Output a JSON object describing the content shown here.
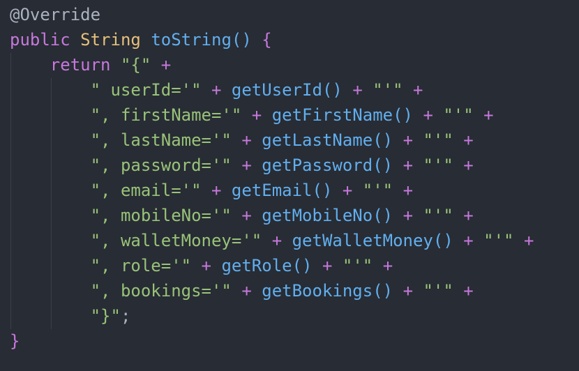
{
  "colors": {
    "background": "#282c34",
    "keyword": "#c678dd",
    "type": "#e5c07b",
    "function": "#61afef",
    "string": "#98c379",
    "plain": "#abb2bf"
  },
  "lines": [
    [
      {
        "c": "t-annotation",
        "t": "@Override"
      }
    ],
    [
      {
        "c": "t-keyword",
        "t": "public"
      },
      {
        "c": "t-plain",
        "t": " "
      },
      {
        "c": "t-type",
        "t": "String"
      },
      {
        "c": "t-plain",
        "t": " "
      },
      {
        "c": "t-func",
        "t": "toString"
      },
      {
        "c": "t-paren",
        "t": "()"
      },
      {
        "c": "t-plain",
        "t": " "
      },
      {
        "c": "t-brace",
        "t": "{"
      }
    ],
    [
      {
        "c": "t-plain",
        "t": "    "
      },
      {
        "c": "t-keyword",
        "t": "return"
      },
      {
        "c": "t-plain",
        "t": " "
      },
      {
        "c": "t-string",
        "t": "\"{\""
      },
      {
        "c": "t-plain",
        "t": " "
      },
      {
        "c": "t-op",
        "t": "+"
      }
    ],
    [
      {
        "c": "t-plain",
        "t": "        "
      },
      {
        "c": "t-string",
        "t": "\" userId='\""
      },
      {
        "c": "t-plain",
        "t": " "
      },
      {
        "c": "t-op",
        "t": "+"
      },
      {
        "c": "t-plain",
        "t": " "
      },
      {
        "c": "t-func",
        "t": "getUserId"
      },
      {
        "c": "t-paren",
        "t": "()"
      },
      {
        "c": "t-plain",
        "t": " "
      },
      {
        "c": "t-op",
        "t": "+"
      },
      {
        "c": "t-plain",
        "t": " "
      },
      {
        "c": "t-string",
        "t": "\"'\""
      },
      {
        "c": "t-plain",
        "t": " "
      },
      {
        "c": "t-op",
        "t": "+"
      }
    ],
    [
      {
        "c": "t-plain",
        "t": "        "
      },
      {
        "c": "t-string",
        "t": "\", firstName='\""
      },
      {
        "c": "t-plain",
        "t": " "
      },
      {
        "c": "t-op",
        "t": "+"
      },
      {
        "c": "t-plain",
        "t": " "
      },
      {
        "c": "t-func",
        "t": "getFirstName"
      },
      {
        "c": "t-paren",
        "t": "()"
      },
      {
        "c": "t-plain",
        "t": " "
      },
      {
        "c": "t-op",
        "t": "+"
      },
      {
        "c": "t-plain",
        "t": " "
      },
      {
        "c": "t-string",
        "t": "\"'\""
      },
      {
        "c": "t-plain",
        "t": " "
      },
      {
        "c": "t-op",
        "t": "+"
      }
    ],
    [
      {
        "c": "t-plain",
        "t": "        "
      },
      {
        "c": "t-string",
        "t": "\", lastName='\""
      },
      {
        "c": "t-plain",
        "t": " "
      },
      {
        "c": "t-op",
        "t": "+"
      },
      {
        "c": "t-plain",
        "t": " "
      },
      {
        "c": "t-func",
        "t": "getLastName"
      },
      {
        "c": "t-paren",
        "t": "()"
      },
      {
        "c": "t-plain",
        "t": " "
      },
      {
        "c": "t-op",
        "t": "+"
      },
      {
        "c": "t-plain",
        "t": " "
      },
      {
        "c": "t-string",
        "t": "\"'\""
      },
      {
        "c": "t-plain",
        "t": " "
      },
      {
        "c": "t-op",
        "t": "+"
      }
    ],
    [
      {
        "c": "t-plain",
        "t": "        "
      },
      {
        "c": "t-string",
        "t": "\", password='\""
      },
      {
        "c": "t-plain",
        "t": " "
      },
      {
        "c": "t-op",
        "t": "+"
      },
      {
        "c": "t-plain",
        "t": " "
      },
      {
        "c": "t-func",
        "t": "getPassword"
      },
      {
        "c": "t-paren",
        "t": "()"
      },
      {
        "c": "t-plain",
        "t": " "
      },
      {
        "c": "t-op",
        "t": "+"
      },
      {
        "c": "t-plain",
        "t": " "
      },
      {
        "c": "t-string",
        "t": "\"'\""
      },
      {
        "c": "t-plain",
        "t": " "
      },
      {
        "c": "t-op",
        "t": "+"
      }
    ],
    [
      {
        "c": "t-plain",
        "t": "        "
      },
      {
        "c": "t-string",
        "t": "\", email='\""
      },
      {
        "c": "t-plain",
        "t": " "
      },
      {
        "c": "t-op",
        "t": "+"
      },
      {
        "c": "t-plain",
        "t": " "
      },
      {
        "c": "t-func",
        "t": "getEmail"
      },
      {
        "c": "t-paren",
        "t": "()"
      },
      {
        "c": "t-plain",
        "t": " "
      },
      {
        "c": "t-op",
        "t": "+"
      },
      {
        "c": "t-plain",
        "t": " "
      },
      {
        "c": "t-string",
        "t": "\"'\""
      },
      {
        "c": "t-plain",
        "t": " "
      },
      {
        "c": "t-op",
        "t": "+"
      }
    ],
    [
      {
        "c": "t-plain",
        "t": "        "
      },
      {
        "c": "t-string",
        "t": "\", mobileNo='\""
      },
      {
        "c": "t-plain",
        "t": " "
      },
      {
        "c": "t-op",
        "t": "+"
      },
      {
        "c": "t-plain",
        "t": " "
      },
      {
        "c": "t-func",
        "t": "getMobileNo"
      },
      {
        "c": "t-paren",
        "t": "()"
      },
      {
        "c": "t-plain",
        "t": " "
      },
      {
        "c": "t-op",
        "t": "+"
      },
      {
        "c": "t-plain",
        "t": " "
      },
      {
        "c": "t-string",
        "t": "\"'\""
      },
      {
        "c": "t-plain",
        "t": " "
      },
      {
        "c": "t-op",
        "t": "+"
      }
    ],
    [
      {
        "c": "t-plain",
        "t": "        "
      },
      {
        "c": "t-string",
        "t": "\", walletMoney='\""
      },
      {
        "c": "t-plain",
        "t": " "
      },
      {
        "c": "t-op",
        "t": "+"
      },
      {
        "c": "t-plain",
        "t": " "
      },
      {
        "c": "t-func",
        "t": "getWalletMoney"
      },
      {
        "c": "t-paren",
        "t": "()"
      },
      {
        "c": "t-plain",
        "t": " "
      },
      {
        "c": "t-op",
        "t": "+"
      },
      {
        "c": "t-plain",
        "t": " "
      },
      {
        "c": "t-string",
        "t": "\"'\""
      },
      {
        "c": "t-plain",
        "t": " "
      },
      {
        "c": "t-op",
        "t": "+"
      }
    ],
    [
      {
        "c": "t-plain",
        "t": "        "
      },
      {
        "c": "t-string",
        "t": "\", role='\""
      },
      {
        "c": "t-plain",
        "t": " "
      },
      {
        "c": "t-op",
        "t": "+"
      },
      {
        "c": "t-plain",
        "t": " "
      },
      {
        "c": "t-func",
        "t": "getRole"
      },
      {
        "c": "t-paren",
        "t": "()"
      },
      {
        "c": "t-plain",
        "t": " "
      },
      {
        "c": "t-op",
        "t": "+"
      },
      {
        "c": "t-plain",
        "t": " "
      },
      {
        "c": "t-string",
        "t": "\"'\""
      },
      {
        "c": "t-plain",
        "t": " "
      },
      {
        "c": "t-op",
        "t": "+"
      }
    ],
    [
      {
        "c": "t-plain",
        "t": "        "
      },
      {
        "c": "t-string",
        "t": "\", bookings='\""
      },
      {
        "c": "t-plain",
        "t": " "
      },
      {
        "c": "t-op",
        "t": "+"
      },
      {
        "c": "t-plain",
        "t": " "
      },
      {
        "c": "t-func",
        "t": "getBookings"
      },
      {
        "c": "t-paren",
        "t": "()"
      },
      {
        "c": "t-plain",
        "t": " "
      },
      {
        "c": "t-op",
        "t": "+"
      },
      {
        "c": "t-plain",
        "t": " "
      },
      {
        "c": "t-string",
        "t": "\"'\""
      },
      {
        "c": "t-plain",
        "t": " "
      },
      {
        "c": "t-op",
        "t": "+"
      }
    ],
    [
      {
        "c": "t-plain",
        "t": "        "
      },
      {
        "c": "t-string",
        "t": "\"}\""
      },
      {
        "c": "t-plain",
        "t": ";"
      }
    ],
    [
      {
        "c": "t-brace",
        "t": "}"
      }
    ]
  ]
}
